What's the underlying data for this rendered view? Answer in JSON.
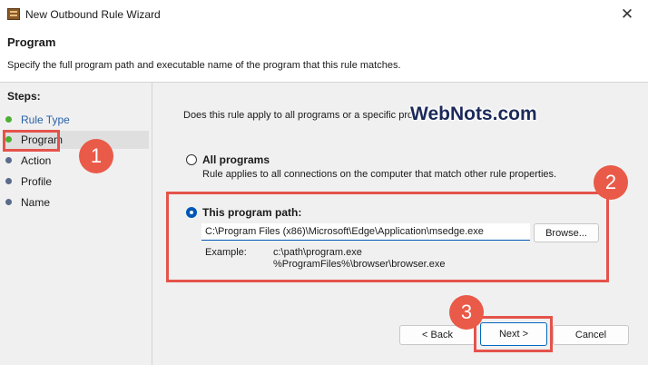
{
  "window": {
    "title": "New Outbound Rule Wizard",
    "close_glyph": "✕"
  },
  "header": {
    "title": "Program",
    "description": "Specify the full program path and executable name of the program that this rule matches."
  },
  "sidebar": {
    "steps_label": "Steps:",
    "items": [
      {
        "label": "Rule Type",
        "state": "done"
      },
      {
        "label": "Program",
        "state": "current"
      },
      {
        "label": "Action",
        "state": "pending"
      },
      {
        "label": "Profile",
        "state": "pending"
      },
      {
        "label": "Name",
        "state": "pending"
      }
    ]
  },
  "main": {
    "question": "Does this rule apply to all programs or a specific prog",
    "all_programs": {
      "label": "All programs",
      "description": "Rule applies to all connections on the computer that match other rule properties.",
      "selected": false
    },
    "program_path": {
      "label": "This program path:",
      "value": "C:\\Program Files (x86)\\Microsoft\\Edge\\Application\\msedge.exe",
      "selected": true
    },
    "browse_label": "Browse...",
    "example_label": "Example:",
    "example_values": [
      "c:\\path\\program.exe",
      "%ProgramFiles%\\browser\\browser.exe"
    ]
  },
  "footer": {
    "back_label": "< Back",
    "next_label": "Next >",
    "cancel_label": "Cancel"
  },
  "annotations": {
    "badge_1": "1",
    "badge_2": "2",
    "badge_3": "3",
    "watermark": "WebNots.com"
  },
  "colors": {
    "callout": "#e5534b",
    "badge": "#ea5a48",
    "accent": "#0057b8",
    "done_dot": "#4caf32"
  },
  "icons": {
    "app": "firewall-rule-icon",
    "close": "close-icon"
  }
}
